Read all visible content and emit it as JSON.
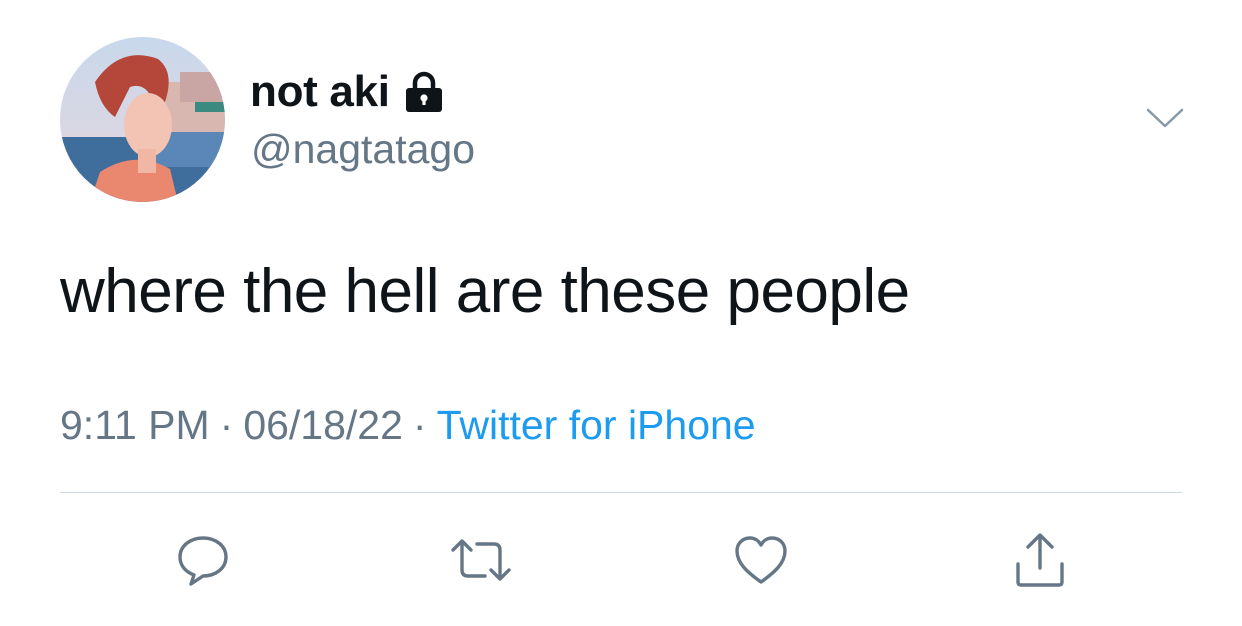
{
  "tweet": {
    "display_name": "not aki",
    "handle": "@nagtatago",
    "text": "where the hell are these people",
    "time": "9:11 PM",
    "separator": "·",
    "date": "06/18/22",
    "source": "Twitter for iPhone"
  },
  "icons": {
    "lock": "lock-icon",
    "chevron": "chevron-down-icon",
    "reply": "reply-icon",
    "retweet": "retweet-icon",
    "like": "heart-icon",
    "share": "share-icon"
  },
  "colors": {
    "text": "#0f1419",
    "secondary": "#657786",
    "link": "#1d9bf0",
    "divider": "#cfd9de"
  }
}
